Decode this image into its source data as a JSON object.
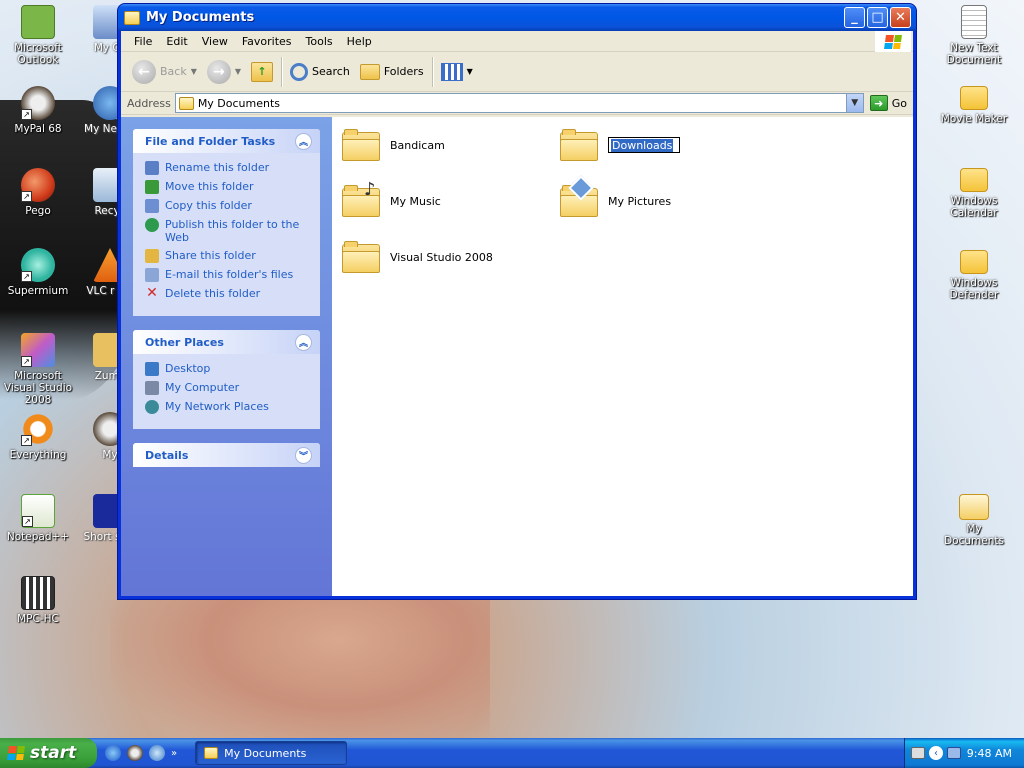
{
  "desktop": {
    "icons_left": [
      {
        "label": "Microsoft Outlook",
        "icon": "outlook-icon",
        "color": "#7ab648"
      },
      {
        "label": "MyPal 68",
        "icon": "mypal-icon",
        "color": "#5a4a3a"
      },
      {
        "label": "Pego",
        "icon": "pego-icon",
        "color": "#d03a1a"
      },
      {
        "label": "Supermium",
        "icon": "supermium-icon",
        "color": "#2fb4a0"
      },
      {
        "label": "Microsoft Visual Studio 2008",
        "icon": "visual-studio-icon",
        "color": "#c05cc8"
      },
      {
        "label": "Everything",
        "icon": "everything-icon",
        "color": "#f08a1a"
      },
      {
        "label": "Notepad++",
        "icon": "notepadpp-icon",
        "color": "#5ba33a"
      },
      {
        "label": "MPC-HC",
        "icon": "mpc-hc-icon",
        "color": "#333333"
      }
    ],
    "icons_left2": [
      {
        "label": "My Co",
        "icon": "my-computer-icon"
      },
      {
        "label": "My Ne Pla",
        "icon": "network-places-icon"
      },
      {
        "label": "Recyc",
        "icon": "recycle-bin-icon"
      },
      {
        "label": "VLC r pla",
        "icon": "vlc-icon"
      },
      {
        "label": "Zuma",
        "icon": "zuma-icon"
      },
      {
        "label": "My",
        "icon": "my-icon"
      },
      {
        "label": "Short side",
        "icon": "shortcut-icon"
      }
    ],
    "icons_right": [
      {
        "label": "New Text Document",
        "icon": "text-document-icon"
      },
      {
        "label": "Movie Maker",
        "icon": "folder-icon"
      },
      {
        "label": "Windows Calendar",
        "icon": "folder-icon"
      },
      {
        "label": "Windows Defender",
        "icon": "folder-icon"
      },
      {
        "label": "My Documents",
        "icon": "my-documents-icon"
      }
    ]
  },
  "window": {
    "title": "My Documents",
    "menu": [
      "File",
      "Edit",
      "View",
      "Favorites",
      "Tools",
      "Help"
    ],
    "toolbar": {
      "back": "Back",
      "search": "Search",
      "folders": "Folders"
    },
    "address": {
      "label": "Address",
      "value": "My Documents",
      "go": "Go"
    },
    "task_panels": [
      {
        "title": "File and Folder Tasks",
        "links": [
          {
            "label": "Rename this folder",
            "icon": "rename-icon",
            "color": "#5b7fc7"
          },
          {
            "label": "Move this folder",
            "icon": "move-icon",
            "color": "#3a9a3a"
          },
          {
            "label": "Copy this folder",
            "icon": "copy-icon",
            "color": "#6d8ed0"
          },
          {
            "label": "Publish this folder to the Web",
            "icon": "publish-icon",
            "color": "#2e9a4e"
          },
          {
            "label": "Share this folder",
            "icon": "share-icon",
            "color": "#e2b640"
          },
          {
            "label": "E-mail this folder's files",
            "icon": "email-icon",
            "color": "#8aa6d6"
          },
          {
            "label": "Delete this folder",
            "icon": "delete-icon",
            "color": "#d02a2a"
          }
        ]
      },
      {
        "title": "Other Places",
        "links": [
          {
            "label": "Desktop",
            "icon": "desktop-icon",
            "color": "#3a78c8"
          },
          {
            "label": "My Computer",
            "icon": "my-computer-icon",
            "color": "#7a8aa6"
          },
          {
            "label": "My Network Places",
            "icon": "network-icon",
            "color": "#3a8a9a"
          }
        ]
      },
      {
        "title": "Details",
        "links": []
      }
    ],
    "files": [
      {
        "name": "Bandicam",
        "icon": "folder-icon"
      },
      {
        "name": "Downloads",
        "icon": "folder-icon",
        "renaming": true
      },
      {
        "name": "My Music",
        "icon": "music-folder-icon"
      },
      {
        "name": "My Pictures",
        "icon": "pictures-folder-icon"
      },
      {
        "name": "Visual Studio 2008",
        "icon": "folder-icon"
      }
    ]
  },
  "taskbar": {
    "start": "start",
    "task": "My Documents",
    "clock": "9:48 AM"
  }
}
